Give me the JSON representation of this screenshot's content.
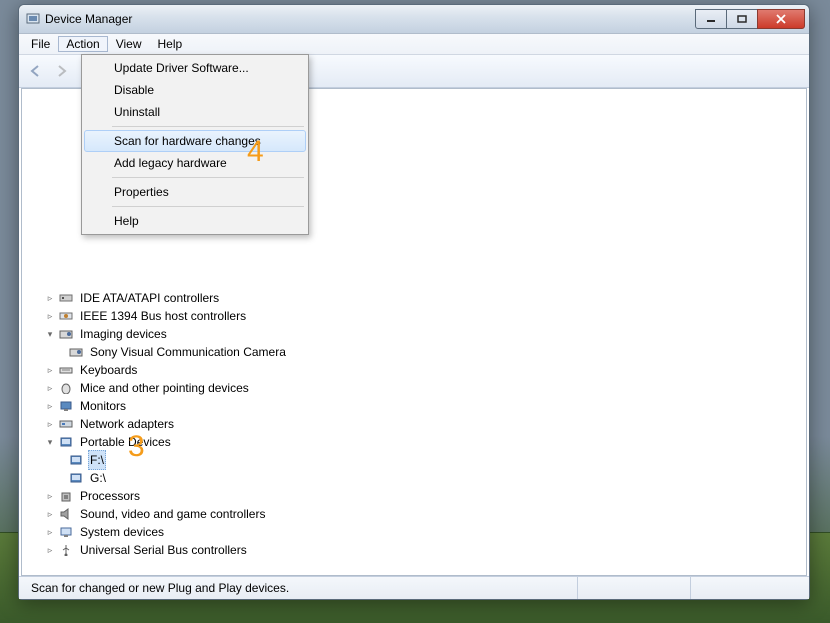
{
  "window": {
    "title": "Device Manager"
  },
  "menubar": {
    "file": "File",
    "action": "Action",
    "view": "View",
    "help": "Help"
  },
  "action_menu": {
    "update_driver": "Update Driver Software...",
    "disable": "Disable",
    "uninstall": "Uninstall",
    "scan": "Scan for hardware changes",
    "add_legacy": "Add legacy hardware",
    "properties": "Properties",
    "help": "Help"
  },
  "tree": {
    "root": "(computer)",
    "ide": "IDE ATA/ATAPI controllers",
    "ieee": "IEEE 1394 Bus host controllers",
    "imaging": "Imaging devices",
    "imaging_child": "Sony Visual Communication Camera",
    "keyboards": "Keyboards",
    "mice": "Mice and other pointing devices",
    "monitors": "Monitors",
    "network": "Network adapters",
    "portable": "Portable Devices",
    "portable_f": "F:\\",
    "portable_g": "G:\\",
    "processors": "Processors",
    "sound": "Sound, video and game controllers",
    "system": "System devices",
    "usb": "Universal Serial Bus controllers"
  },
  "statusbar": {
    "text": "Scan for changed or new Plug and Play devices."
  },
  "annotations": {
    "n3": "3",
    "n4": "4"
  }
}
